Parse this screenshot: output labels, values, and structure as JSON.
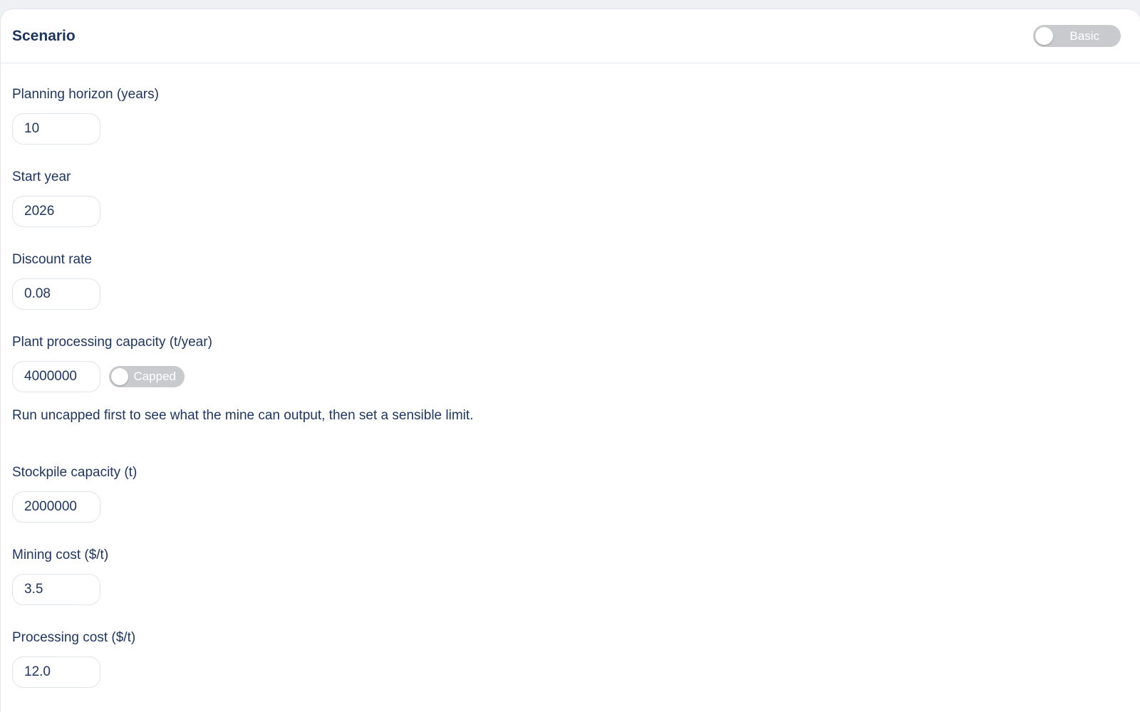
{
  "header": {
    "title": "Scenario",
    "mode_toggle_label": "Basic"
  },
  "fields": {
    "planning_horizon": {
      "label": "Planning horizon (years)",
      "value": "10"
    },
    "start_year": {
      "label": "Start year",
      "value": "2026"
    },
    "discount_rate": {
      "label": "Discount rate",
      "value": "0.08"
    },
    "plant_capacity": {
      "label": "Plant processing capacity (t/year)",
      "value": "4000000",
      "toggle_label": "Capped",
      "hint": "Run uncapped first to see what the mine can output, then set a sensible limit."
    },
    "stockpile_capacity": {
      "label": "Stockpile capacity (t)",
      "value": "2000000"
    },
    "mining_cost": {
      "label": "Mining cost ($/t)",
      "value": "3.5"
    },
    "processing_cost": {
      "label": "Processing cost ($/t)",
      "value": "12.0"
    }
  },
  "colors": {
    "text": "#1f3564",
    "toggle_off": "#c9cacd",
    "input_border": "#dfe3ea",
    "background": "#eef0f4"
  }
}
